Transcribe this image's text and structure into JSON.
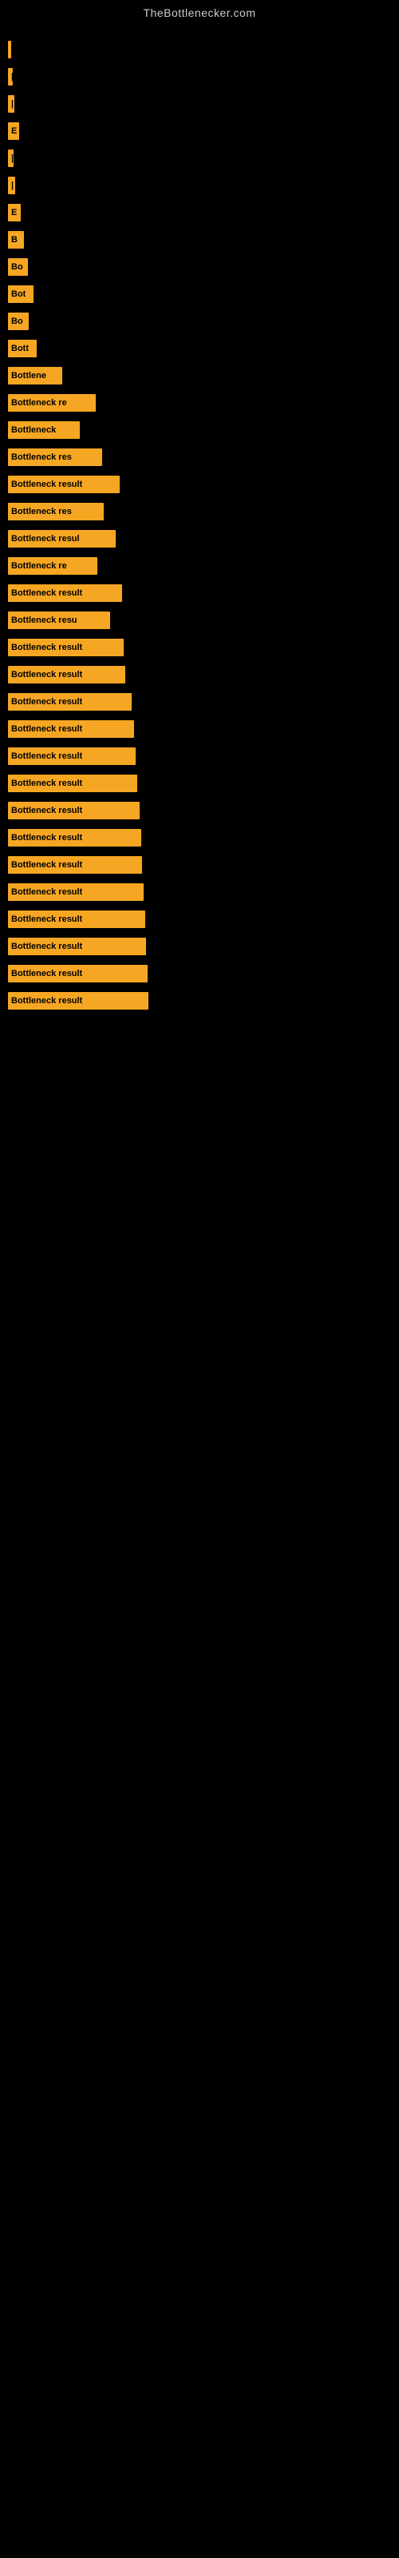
{
  "site_title": "TheBottlenecker.com",
  "bars": [
    {
      "id": 1,
      "label": "|",
      "width": 4
    },
    {
      "id": 2,
      "label": "|",
      "width": 6
    },
    {
      "id": 3,
      "label": "|",
      "width": 8
    },
    {
      "id": 4,
      "label": "E",
      "width": 14
    },
    {
      "id": 5,
      "label": "|",
      "width": 7
    },
    {
      "id": 6,
      "label": "|",
      "width": 9
    },
    {
      "id": 7,
      "label": "E",
      "width": 16
    },
    {
      "id": 8,
      "label": "B",
      "width": 20
    },
    {
      "id": 9,
      "label": "Bo",
      "width": 25
    },
    {
      "id": 10,
      "label": "Bot",
      "width": 32
    },
    {
      "id": 11,
      "label": "Bo",
      "width": 26
    },
    {
      "id": 12,
      "label": "Bott",
      "width": 36
    },
    {
      "id": 13,
      "label": "Bottlene",
      "width": 68
    },
    {
      "id": 14,
      "label": "Bottleneck re",
      "width": 110
    },
    {
      "id": 15,
      "label": "Bottleneck",
      "width": 90
    },
    {
      "id": 16,
      "label": "Bottleneck res",
      "width": 118
    },
    {
      "id": 17,
      "label": "Bottleneck result",
      "width": 140
    },
    {
      "id": 18,
      "label": "Bottleneck res",
      "width": 120
    },
    {
      "id": 19,
      "label": "Bottleneck resul",
      "width": 135
    },
    {
      "id": 20,
      "label": "Bottleneck re",
      "width": 112
    },
    {
      "id": 21,
      "label": "Bottleneck result",
      "width": 143
    },
    {
      "id": 22,
      "label": "Bottleneck resu",
      "width": 128
    },
    {
      "id": 23,
      "label": "Bottleneck result",
      "width": 145
    },
    {
      "id": 24,
      "label": "Bottleneck result",
      "width": 147
    },
    {
      "id": 25,
      "label": "Bottleneck result",
      "width": 155
    },
    {
      "id": 26,
      "label": "Bottleneck result",
      "width": 158
    },
    {
      "id": 27,
      "label": "Bottleneck result",
      "width": 160
    },
    {
      "id": 28,
      "label": "Bottleneck result",
      "width": 162
    },
    {
      "id": 29,
      "label": "Bottleneck result",
      "width": 165
    },
    {
      "id": 30,
      "label": "Bottleneck result",
      "width": 167
    },
    {
      "id": 31,
      "label": "Bottleneck result",
      "width": 168
    },
    {
      "id": 32,
      "label": "Bottleneck result",
      "width": 170
    },
    {
      "id": 33,
      "label": "Bottleneck result",
      "width": 172
    },
    {
      "id": 34,
      "label": "Bottleneck result",
      "width": 173
    },
    {
      "id": 35,
      "label": "Bottleneck result",
      "width": 175
    },
    {
      "id": 36,
      "label": "Bottleneck result",
      "width": 176
    }
  ]
}
